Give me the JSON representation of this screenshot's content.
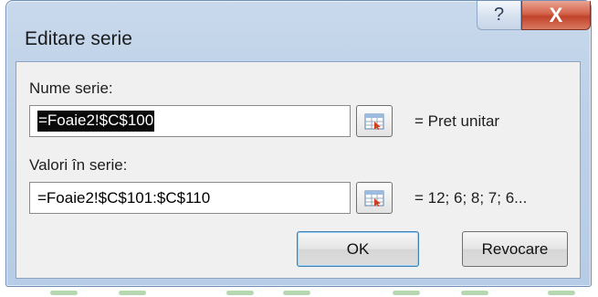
{
  "dialog": {
    "title": "Editare serie",
    "help_glyph": "?",
    "close_glyph": "X"
  },
  "series_name": {
    "label": "Nume serie:",
    "value": "=Foaie2!$C$100",
    "result": "= Pret unitar"
  },
  "series_values": {
    "label": "Valori în serie:",
    "value": "=Foaie2!$C$101:$C$110",
    "result": "= 12; 6; 8; 7; 6..."
  },
  "buttons": {
    "ok": "OK",
    "cancel": "Revocare"
  },
  "icons": {
    "collapse": "range-selector-icon"
  },
  "colors": {
    "title_bar": "#bcd0e8",
    "close_button": "#c0432a",
    "client_bg": "#f0f0f0",
    "selection_bg": "#0a0a0a",
    "default_button_border": "#3c7fb1"
  }
}
